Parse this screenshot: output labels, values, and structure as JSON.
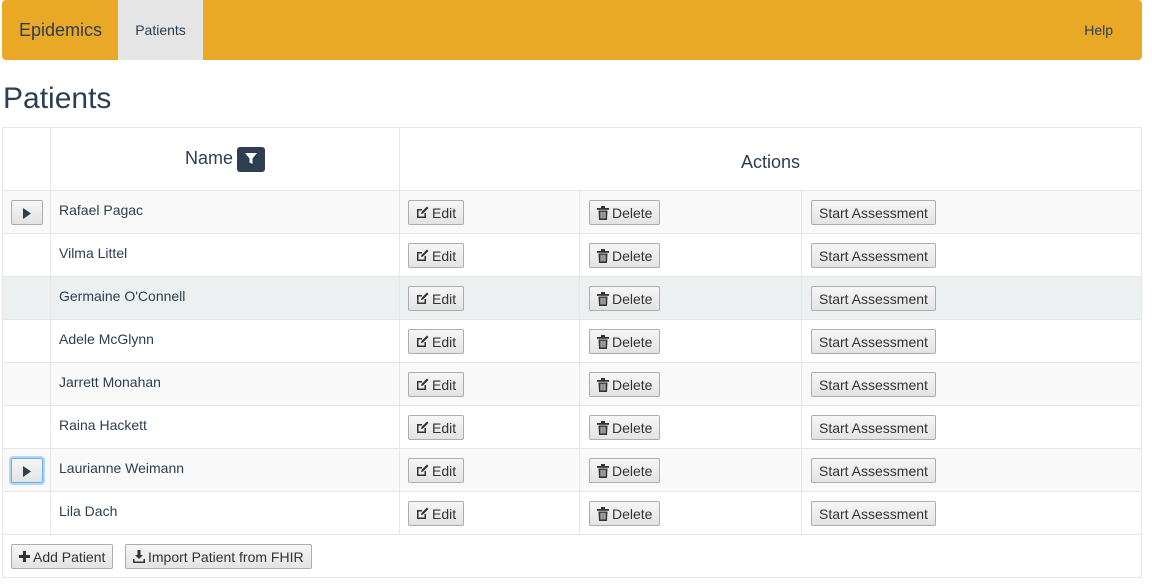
{
  "navbar": {
    "brand": "Epidemics",
    "active_tab": "Patients",
    "help": "Help",
    "color": "#e9a825"
  },
  "page_title": "Patients",
  "table": {
    "headers": {
      "name": "Name",
      "actions": "Actions"
    },
    "filter_icon": "filter-icon",
    "rows": [
      {
        "name": "Rafael Pagac",
        "expandable": true
      },
      {
        "name": "Vilma Littel",
        "expandable": false
      },
      {
        "name": "Germaine O'Connell",
        "expandable": false
      },
      {
        "name": "Adele McGlynn",
        "expandable": false
      },
      {
        "name": "Jarrett Monahan",
        "expandable": false
      },
      {
        "name": "Raina Hackett",
        "expandable": false
      },
      {
        "name": "Laurianne Weimann",
        "expandable": true
      },
      {
        "name": "Lila Dach",
        "expandable": false
      }
    ],
    "row_actions": {
      "edit": "Edit",
      "delete": "Delete",
      "start": "Start Assessment"
    }
  },
  "footer": {
    "add": "Add Patient",
    "import": "Import Patient from FHIR"
  },
  "icons": {
    "edit": "edit-icon",
    "delete": "trash-icon",
    "add": "plus-icon",
    "import": "download-icon",
    "expand": "caret-right-icon"
  }
}
